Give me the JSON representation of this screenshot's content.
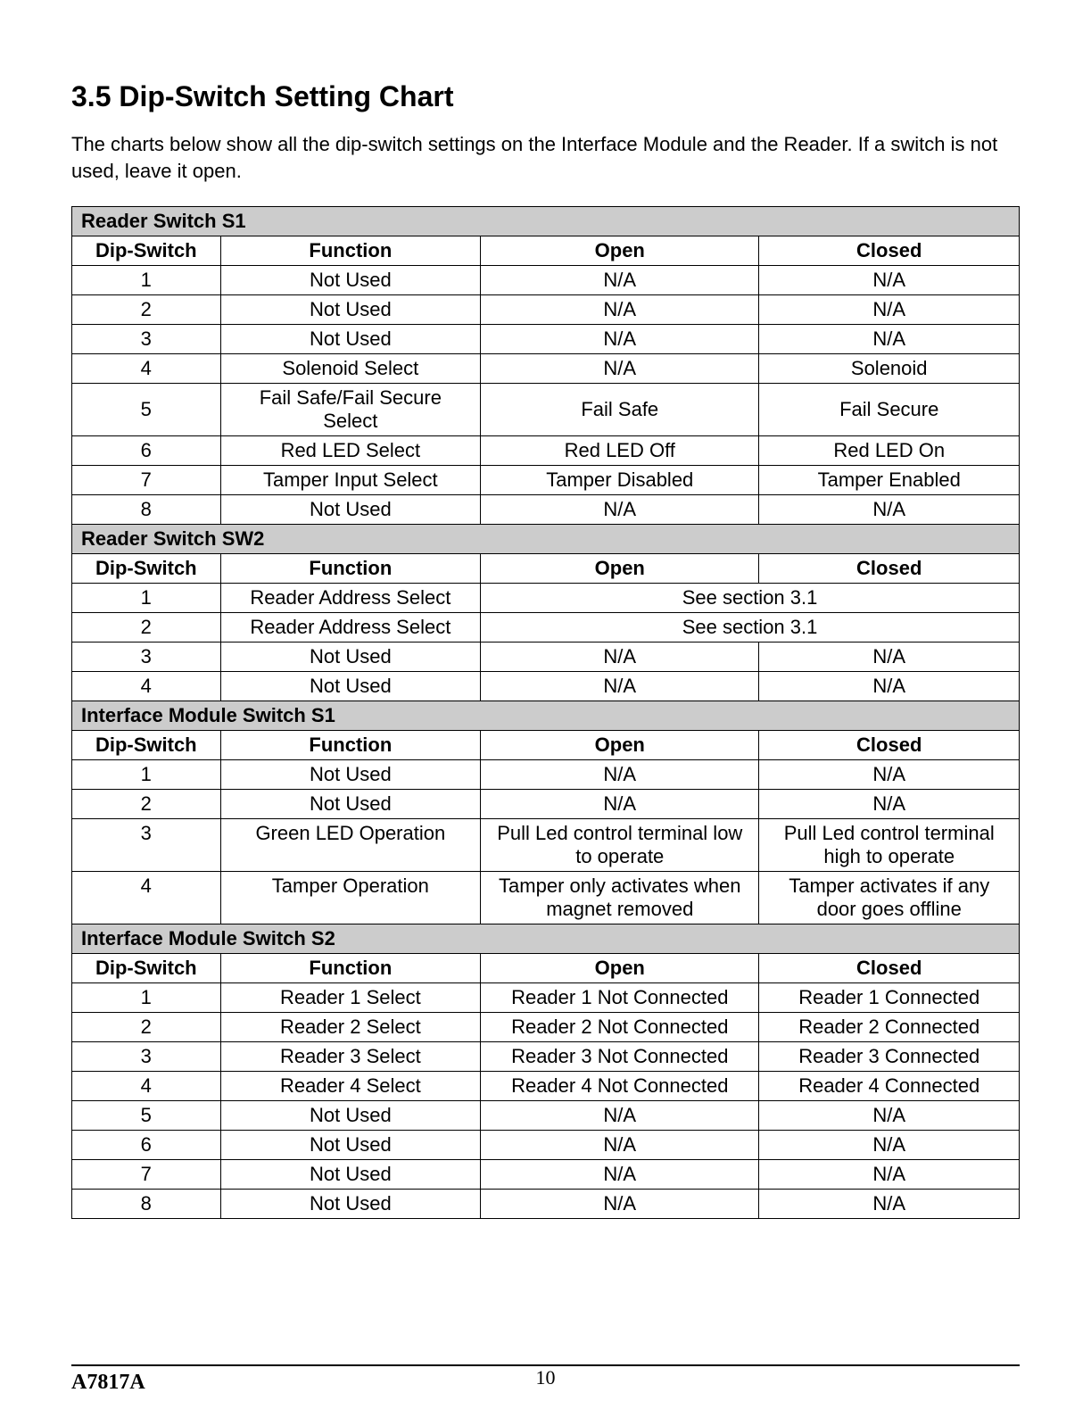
{
  "title": "3.5 Dip-Switch Setting Chart",
  "intro": "The charts below show all the dip-switch settings on the Interface Module and the Reader.  If a switch is not used, leave it open.",
  "headers": {
    "dip": "Dip-Switch",
    "func": "Function",
    "open": "Open",
    "closed": "Closed"
  },
  "sections": {
    "s1": {
      "title": "Reader Switch S1",
      "rows": [
        {
          "n": "1",
          "f": "Not Used",
          "o": "N/A",
          "c": "N/A"
        },
        {
          "n": "2",
          "f": "Not Used",
          "o": "N/A",
          "c": "N/A"
        },
        {
          "n": "3",
          "f": "Not Used",
          "o": "N/A",
          "c": "N/A"
        },
        {
          "n": "4",
          "f": "Solenoid Select",
          "o": "N/A",
          "c": "Solenoid"
        },
        {
          "n": "5",
          "f": "Fail Safe/Fail Secure Select",
          "o": "Fail Safe",
          "c": "Fail Secure"
        },
        {
          "n": "6",
          "f": "Red LED Select",
          "o": "Red LED Off",
          "c": "Red LED On"
        },
        {
          "n": "7",
          "f": "Tamper Input Select",
          "o": "Tamper Disabled",
          "c": "Tamper Enabled"
        },
        {
          "n": "8",
          "f": "Not Used",
          "o": "N/A",
          "c": "N/A"
        }
      ]
    },
    "sw2": {
      "title": "Reader Switch SW2",
      "rows_merged": [
        {
          "n": "1",
          "f": "Reader Address Select",
          "merged": "See section 3.1"
        },
        {
          "n": "2",
          "f": "Reader Address Select",
          "merged": "See section 3.1"
        }
      ],
      "rows": [
        {
          "n": "3",
          "f": "Not Used",
          "o": "N/A",
          "c": "N/A"
        },
        {
          "n": "4",
          "f": "Not Used",
          "o": "N/A",
          "c": "N/A"
        }
      ]
    },
    "ims1": {
      "title": "Interface Module Switch S1",
      "rows": [
        {
          "n": "1",
          "f": "Not Used",
          "o": "N/A",
          "c": "N/A"
        },
        {
          "n": "2",
          "f": "Not Used",
          "o": "N/A",
          "c": "N/A"
        },
        {
          "n": "3",
          "f": "Green LED Operation",
          "o": "Pull Led control terminal low to operate",
          "c": "Pull Led control terminal high to operate"
        },
        {
          "n": "4",
          "f": "Tamper Operation",
          "o": "Tamper only activates when magnet removed",
          "c": "Tamper activates if any door goes offline"
        }
      ]
    },
    "ims2": {
      "title": "Interface Module Switch S2",
      "rows": [
        {
          "n": "1",
          "f": "Reader 1 Select",
          "o": "Reader 1 Not Connected",
          "c": "Reader 1 Connected"
        },
        {
          "n": "2",
          "f": "Reader 2 Select",
          "o": "Reader 2 Not Connected",
          "c": "Reader 2 Connected"
        },
        {
          "n": "3",
          "f": "Reader 3 Select",
          "o": "Reader 3 Not Connected",
          "c": "Reader 3 Connected"
        },
        {
          "n": "4",
          "f": "Reader 4 Select",
          "o": "Reader 4 Not Connected",
          "c": "Reader 4 Connected"
        },
        {
          "n": "5",
          "f": "Not Used",
          "o": "N/A",
          "c": "N/A"
        },
        {
          "n": "6",
          "f": "Not Used",
          "o": "N/A",
          "c": "N/A"
        },
        {
          "n": "7",
          "f": "Not Used",
          "o": "N/A",
          "c": "N/A"
        },
        {
          "n": "8",
          "f": "Not Used",
          "o": "N/A",
          "c": "N/A"
        }
      ]
    }
  },
  "footer": {
    "left": "A7817A",
    "center": "10"
  }
}
